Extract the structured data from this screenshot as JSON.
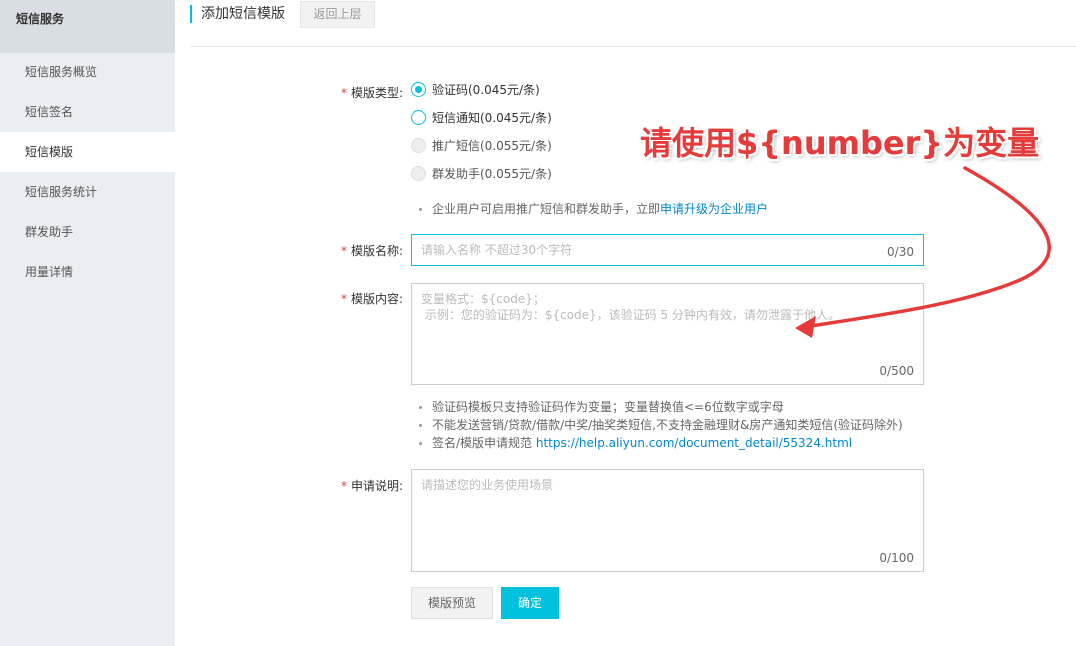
{
  "sidebar": {
    "title": "短信服务",
    "items": [
      {
        "label": "短信服务概览"
      },
      {
        "label": "短信签名"
      },
      {
        "label": "短信模版"
      },
      {
        "label": "短信服务统计"
      },
      {
        "label": "群发助手"
      },
      {
        "label": "用量详情"
      }
    ],
    "active_item": "短信模版"
  },
  "header": {
    "title": "添加短信模版",
    "back_label": "返回上层"
  },
  "form": {
    "required_mark": "*",
    "type_label": "模版类型:",
    "type_options": [
      {
        "label": "验证码(0.045元/条)",
        "state": "selected"
      },
      {
        "label": "短信通知(0.045元/条)",
        "state": "enabled"
      },
      {
        "label": "推广短信(0.055元/条)",
        "state": "disabled"
      },
      {
        "label": "群发助手(0.055元/条)",
        "state": "disabled"
      }
    ],
    "type_tip": "企业用户可启用推广短信和群发助手，立即",
    "type_tip_link": "申请升级为企业用户",
    "name_label": "模版名称:",
    "name_placeholder": "请输入名称 不超过30个字符",
    "name_counter": "0/30",
    "content_label": "模版内容:",
    "content_placeholder": "变量格式：${code}；\n 示例：您的验证码为：${code}，该验证码 5 分钟内有效，请勿泄露于他人。",
    "content_counter": "0/500",
    "content_tips": [
      "验证码模板只支持验证码作为变量；变量替换值<=6位数字或字母",
      "不能发送营销/贷款/借款/中奖/抽奖类短信,不支持金融理财&房产通知类短信(验证码除外)"
    ],
    "spec_tip": "签名/模版申请规范",
    "spec_link": "https://help.aliyun.com/document_detail/55324.html",
    "desc_label": "申请说明:",
    "desc_placeholder": "请描述您的业务使用场景",
    "desc_counter": "0/100",
    "preview_button": "模版预览",
    "submit_button": "确定"
  },
  "annotation": {
    "text": "请使用${number}为变量",
    "color": "#e53b3b"
  },
  "colors": {
    "accent": "#00c1de",
    "link": "#0088cc",
    "required": "#e4393c"
  }
}
